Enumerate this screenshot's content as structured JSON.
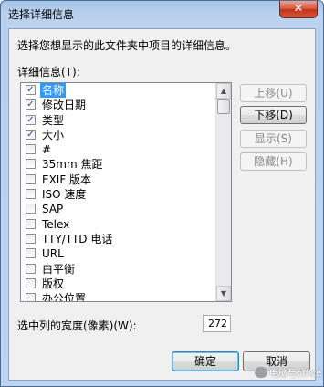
{
  "window": {
    "title": "选择详细信息",
    "close_glyph": "✕"
  },
  "description": "选择您想显示的此文件夹中项目的详细信息。",
  "list_label": "详细信息(T):",
  "items": [
    {
      "label": "名称",
      "checked": true,
      "selected": true
    },
    {
      "label": "修改日期",
      "checked": true,
      "selected": false
    },
    {
      "label": "类型",
      "checked": true,
      "selected": false
    },
    {
      "label": "大小",
      "checked": true,
      "selected": false
    },
    {
      "label": "#",
      "checked": false,
      "selected": false
    },
    {
      "label": "35mm 焦距",
      "checked": false,
      "selected": false
    },
    {
      "label": "EXIF 版本",
      "checked": false,
      "selected": false
    },
    {
      "label": "ISO 速度",
      "checked": false,
      "selected": false
    },
    {
      "label": "SAP",
      "checked": false,
      "selected": false
    },
    {
      "label": "Telex",
      "checked": false,
      "selected": false
    },
    {
      "label": "TTY/TTD 电话",
      "checked": false,
      "selected": false
    },
    {
      "label": "URL",
      "checked": false,
      "selected": false
    },
    {
      "label": "白平衡",
      "checked": false,
      "selected": false
    },
    {
      "label": "版权",
      "checked": false,
      "selected": false
    },
    {
      "label": "办公位置",
      "checked": false,
      "selected": false
    }
  ],
  "check_glyph": "✓",
  "scrollbar": {
    "up_glyph": "▲",
    "down_glyph": "▼"
  },
  "side_buttons": {
    "move_up": "上移(U)",
    "move_down": "下移(D)",
    "show": "显示(S)",
    "hide": "隐藏(H)"
  },
  "width_label": "选中列的宽度(像素)(W):",
  "width_value": "272",
  "buttons": {
    "ok": "确定",
    "cancel": "取消"
  },
  "watermark": "电脑与office",
  "colors": {
    "selection": "#3399ff",
    "title_gradient": "#b9d1ee",
    "close_button": "#c3331b"
  }
}
